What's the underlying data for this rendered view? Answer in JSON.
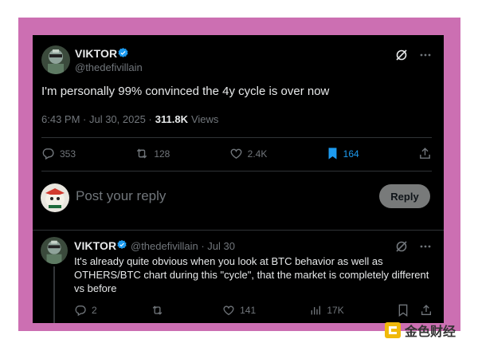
{
  "tweet": {
    "author_name": "VIKTOR",
    "author_handle": "@thedefivillain",
    "text": "I'm personally 99% convinced the 4y cycle is over now",
    "timestamp": "6:43 PM · Jul 30, 2025 · ",
    "views_count": "311.8K",
    "views_label": "Views",
    "actions": {
      "replies": "353",
      "reposts": "128",
      "likes": "2.4K",
      "bookmarks": "164"
    }
  },
  "reply_composer": {
    "placeholder": "Post your reply",
    "button_label": "Reply"
  },
  "reply_tweet": {
    "author_name": "VIKTOR",
    "author_handle": "@thedefivillain · Jul 30",
    "text": "It's already quite obvious when you look at BTC behavior as well as OTHERS/BTC chart during this \"cycle\", that the market is completely different vs before",
    "actions": {
      "replies": "2",
      "reposts": "",
      "likes": "141",
      "views": "17K"
    }
  },
  "watermark": {
    "text": "金色财经"
  },
  "colors": {
    "frame": "#cc6fb2",
    "background": "#000000",
    "text": "#e7e9ea",
    "muted": "#71767b",
    "accent": "#1d9bf0"
  }
}
